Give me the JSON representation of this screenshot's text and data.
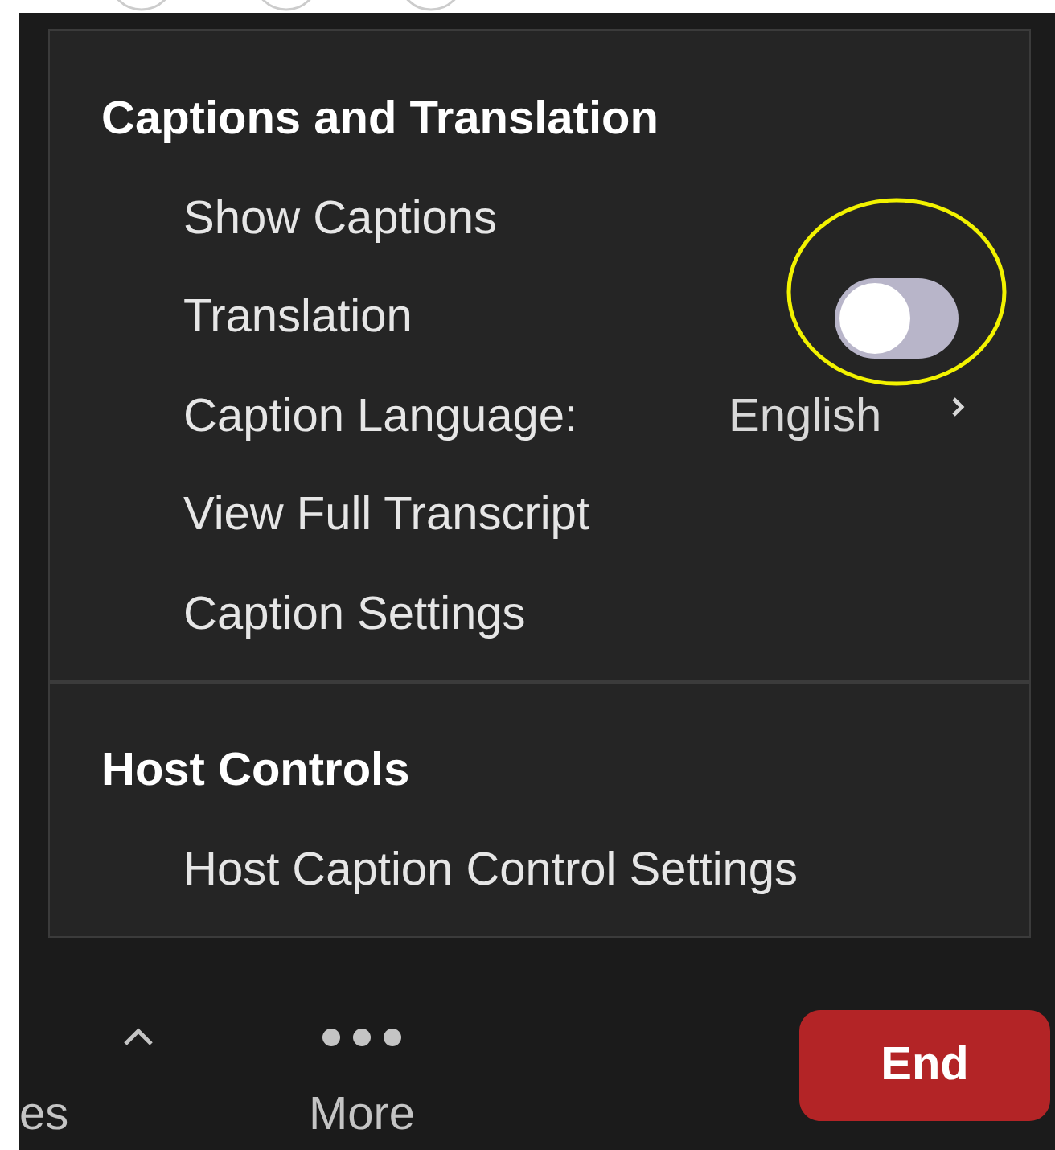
{
  "menu": {
    "sections": [
      {
        "heading": "Captions and Translation",
        "items": [
          {
            "kind": "plain",
            "label": "Show Captions"
          },
          {
            "kind": "toggle",
            "label": "Translation",
            "on": false
          },
          {
            "kind": "submenu",
            "label": "Caption Language:",
            "value": "English"
          },
          {
            "kind": "plain",
            "label": "View Full Transcript"
          },
          {
            "kind": "plain",
            "label": "Caption Settings"
          }
        ]
      },
      {
        "heading": "Host Controls",
        "items": [
          {
            "kind": "plain",
            "label": "Host Caption Control Settings"
          }
        ]
      }
    ]
  },
  "toolbar": {
    "items": [
      {
        "kind": "label",
        "label": "es"
      },
      {
        "kind": "caret"
      },
      {
        "kind": "more",
        "label": "More"
      }
    ],
    "end_button": "End"
  }
}
